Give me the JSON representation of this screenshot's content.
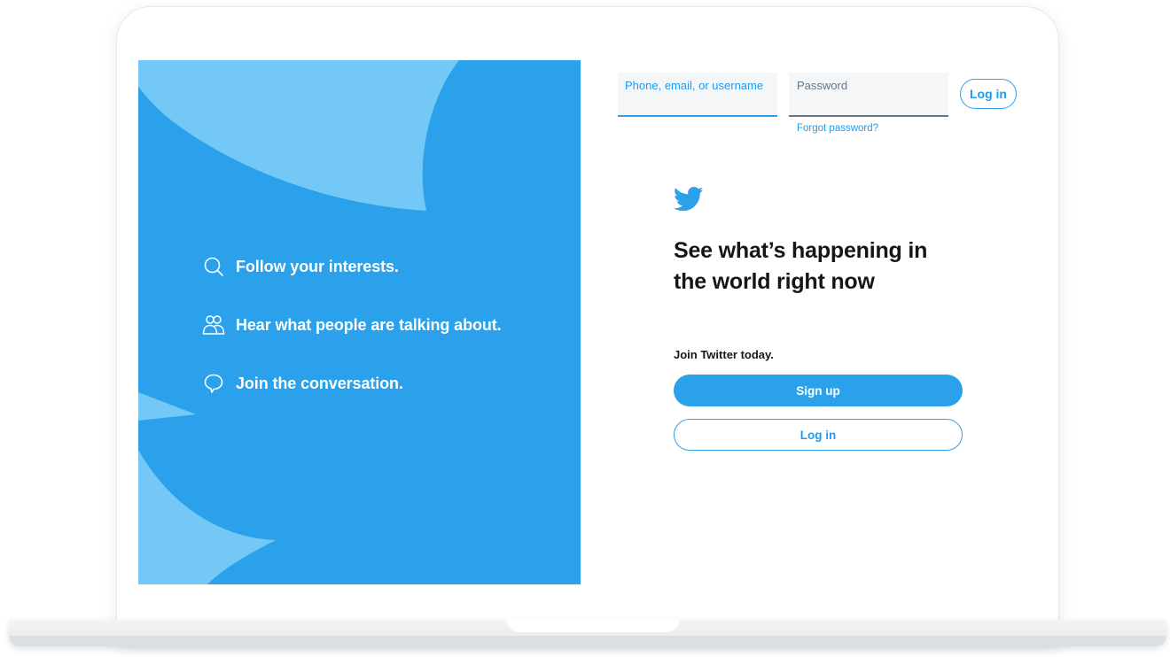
{
  "left_panel": {
    "features": [
      {
        "icon": "search-icon",
        "label": "Follow your interests."
      },
      {
        "icon": "people-icon",
        "label": "Hear what people are talking about."
      },
      {
        "icon": "speech-bubble-icon",
        "label": "Join the conversation."
      }
    ]
  },
  "login_form": {
    "username_placeholder": "Phone, email, or username",
    "password_placeholder": "Password",
    "login_button": "Log in",
    "forgot_password": "Forgot password?"
  },
  "main": {
    "logo_icon": "twitter-bird-icon",
    "headline": "See what’s happening in the world right now",
    "join_text": "Join Twitter today.",
    "signup_button": "Sign up",
    "login_button": "Log in"
  },
  "colors": {
    "brand_blue": "#2aa1ea",
    "light_blue": "#71c9f8",
    "text_dark": "#14171a",
    "link_blue": "#1d9bf0"
  }
}
